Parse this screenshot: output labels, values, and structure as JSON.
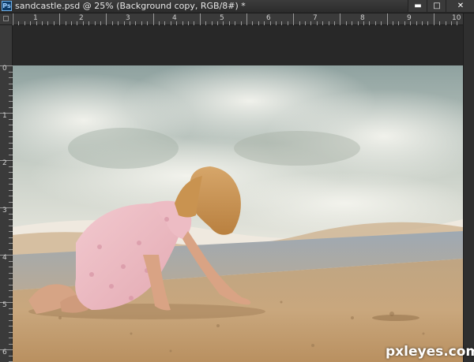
{
  "window": {
    "title": "sandcastle.psd @ 25% (Background copy, RGB/8#) *",
    "app_icon_text": "Ps",
    "controls": {
      "minimize": "▬",
      "maximize": "□",
      "close": "✕"
    }
  },
  "ruler_h": [
    "1",
    "2",
    "3",
    "4",
    "5",
    "6",
    "7",
    "8",
    "9",
    "10"
  ],
  "ruler_v": [
    "0",
    "1",
    "2",
    "3",
    "4",
    "5",
    "6"
  ],
  "canvas": {
    "image": "beach-photo-girl-crawling-on-sand"
  },
  "watermark": "pxleyes.com",
  "colors": {
    "app_bg": "#282828",
    "panel": "#3a3a3a",
    "sand": "#c8a57a",
    "surf": "#dfe3dc"
  }
}
